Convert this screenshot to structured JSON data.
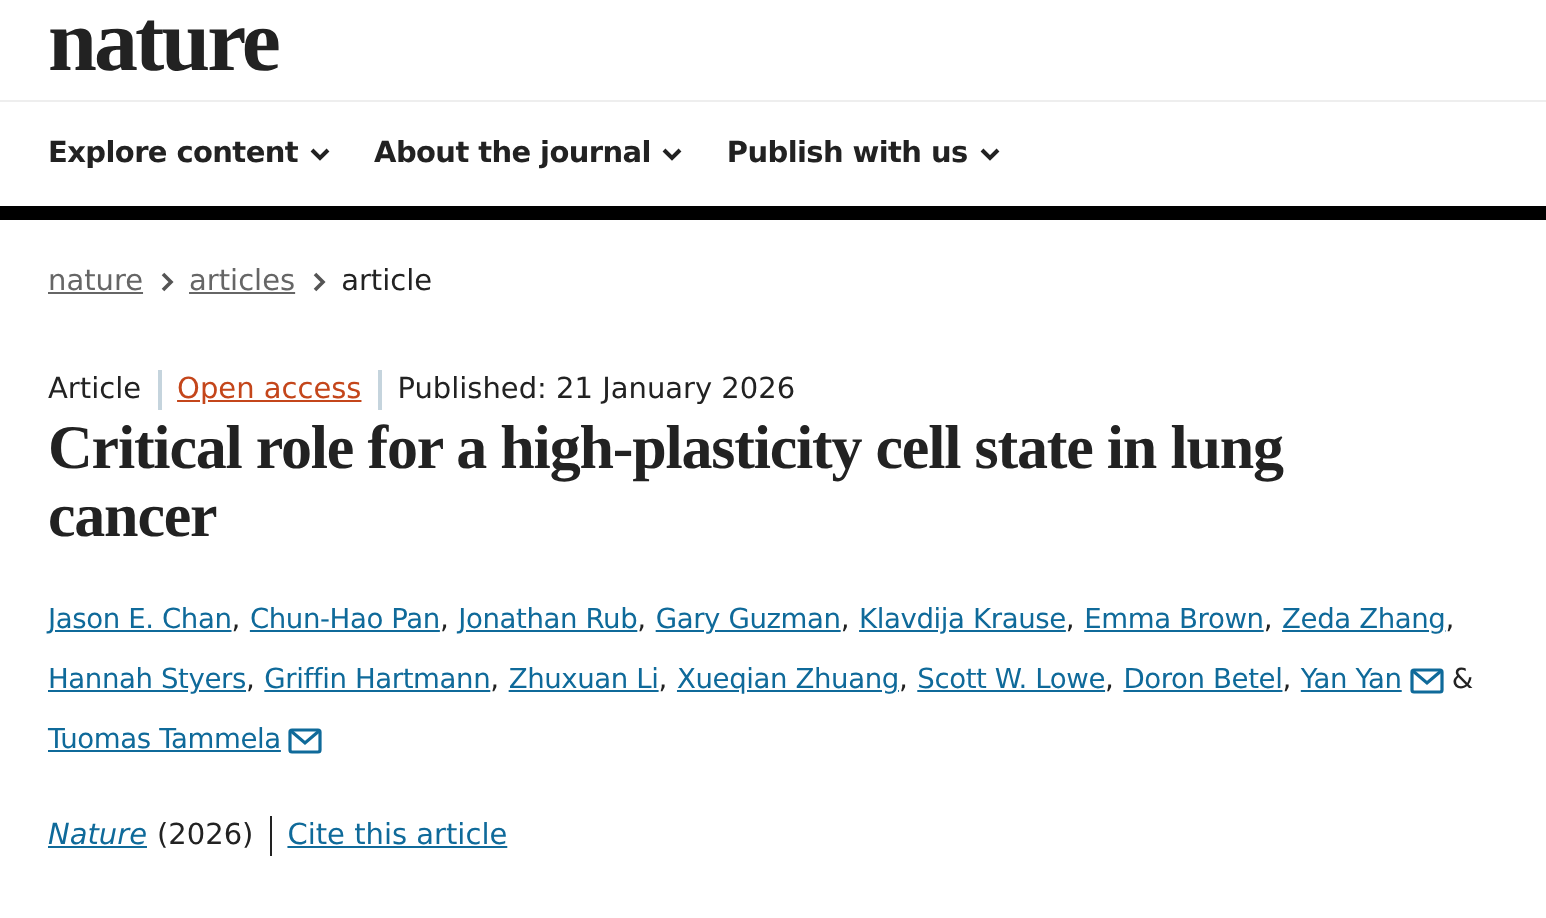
{
  "logo": "nature",
  "nav": [
    {
      "label": "Explore content"
    },
    {
      "label": "About the journal"
    },
    {
      "label": "Publish with us"
    }
  ],
  "breadcrumbs": [
    {
      "label": "nature",
      "link": true
    },
    {
      "label": "articles",
      "link": true
    },
    {
      "label": "article",
      "link": false
    }
  ],
  "meta": {
    "type": "Article",
    "access": "Open access",
    "published": "Published: 21 January 2026"
  },
  "title": "Critical role for a high-plasticity cell state in lung cancer",
  "author_lines": [
    [
      {
        "name": "Jason E. Chan",
        "email": false,
        "sep": ","
      },
      {
        "name": "Chun-Hao Pan",
        "email": false,
        "sep": ","
      },
      {
        "name": "Jonathan Rub",
        "email": false,
        "sep": ","
      },
      {
        "name": "Gary Guzman",
        "email": false,
        "sep": ","
      },
      {
        "name": "Klavdija Krause",
        "email": false,
        "sep": ","
      },
      {
        "name": "Emma Brown",
        "email": false,
        "sep": ","
      },
      {
        "name": "Zeda Zhang",
        "email": false,
        "sep": ","
      }
    ],
    [
      {
        "name": "Hannah Styers",
        "email": false,
        "sep": ","
      },
      {
        "name": "Griffin Hartmann",
        "email": false,
        "sep": ","
      },
      {
        "name": "Zhuxuan Li",
        "email": false,
        "sep": ","
      },
      {
        "name": "Xueqian Zhuang",
        "email": false,
        "sep": ","
      },
      {
        "name": "Scott W. Lowe",
        "email": false,
        "sep": ","
      },
      {
        "name": "Doron Betel",
        "email": false,
        "sep": ","
      },
      {
        "name": "Yan Yan",
        "email": true,
        "sep": "&"
      }
    ],
    [
      {
        "name": "Tuomas Tammela",
        "email": true
      }
    ]
  ],
  "citation": {
    "journal": "Nature",
    "year": "(2026)",
    "cite": "Cite this article"
  }
}
